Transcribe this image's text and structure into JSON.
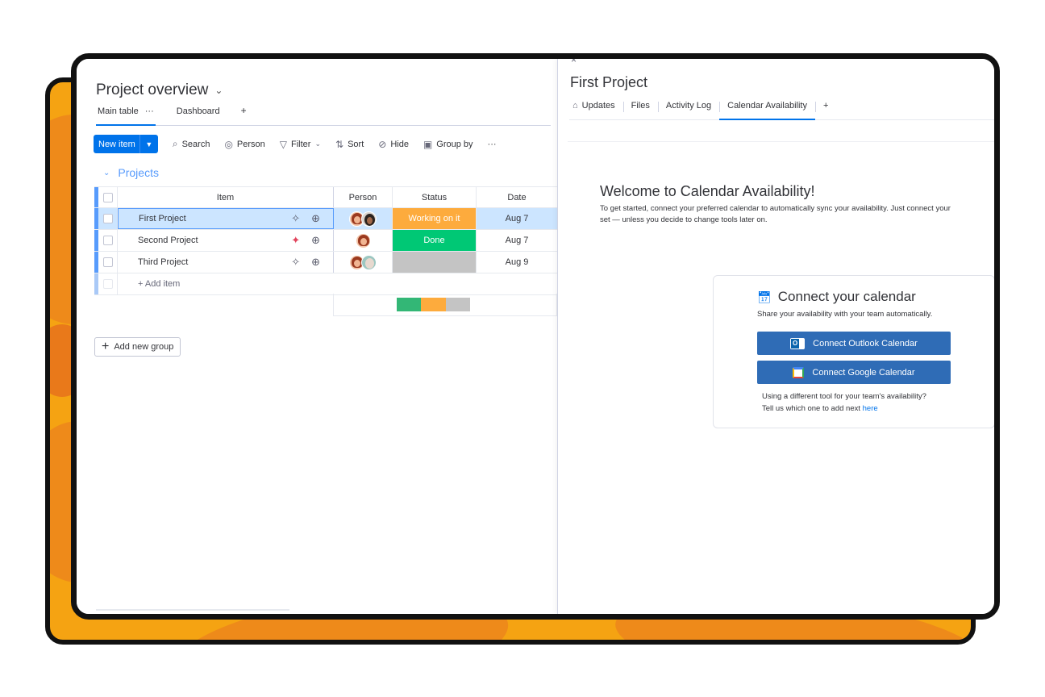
{
  "board": {
    "title": "Project overview",
    "views": [
      {
        "label": "Main table",
        "more": "···"
      },
      {
        "label": "Dashboard"
      }
    ],
    "add_view": "+",
    "toolbar": {
      "new_item": "New item",
      "search": "Search",
      "person": "Person",
      "filter": "Filter",
      "sort": "Sort",
      "hide": "Hide",
      "group_by": "Group by",
      "more": "···"
    },
    "group": {
      "title": "Projects"
    },
    "columns": {
      "item": "Item",
      "person": "Person",
      "status": "Status",
      "date": "Date"
    },
    "rows": [
      {
        "name": "First Project",
        "status": "Working on it",
        "status_color": "#fdab3d",
        "date": "Aug 7",
        "ai_icon": "sparkle-outline-icon"
      },
      {
        "name": "Second Project",
        "status": "Done",
        "status_color": "#00c875",
        "date": "Aug 7",
        "ai_icon": "sparkle-color-icon"
      },
      {
        "name": "Third Project",
        "status": "",
        "status_color": "#c4c4c4",
        "date": "Aug 9",
        "ai_icon": "sparkle-outline-icon"
      }
    ],
    "add_item": "+ Add item",
    "summary": [
      {
        "color": "#33b776",
        "fraction": 0.333
      },
      {
        "color": "#fdab3d",
        "fraction": 0.333
      },
      {
        "color": "#c4c4c4",
        "fraction": 0.333
      }
    ],
    "add_group": "Add new group"
  },
  "panel": {
    "title": "First Project",
    "tabs": [
      "Updates",
      "Files",
      "Activity Log",
      "Calendar Availability"
    ],
    "active_tab": "Calendar Availability",
    "add_tab": "+",
    "welcome_title": "Welcome to Calendar Availability!",
    "welcome_line1": "To get started, connect your preferred calendar to automatically sync your availability. Just connect your",
    "welcome_line2": "set — unless you decide to change tools later on.",
    "connect": {
      "title": "Connect your calendar",
      "subtitle": "Share your availability with your team automatically.",
      "outlook_button": "Connect Outlook Calendar",
      "google_button": "Connect Google Calendar",
      "footer_line1": "Using a different tool for your team's availability?",
      "footer_line2": "Tell us which one to add next",
      "footer_link": "here"
    }
  },
  "colors": {
    "accent": "#0073ea",
    "group": "#579bfc",
    "frame_orange": "#f5a312"
  }
}
